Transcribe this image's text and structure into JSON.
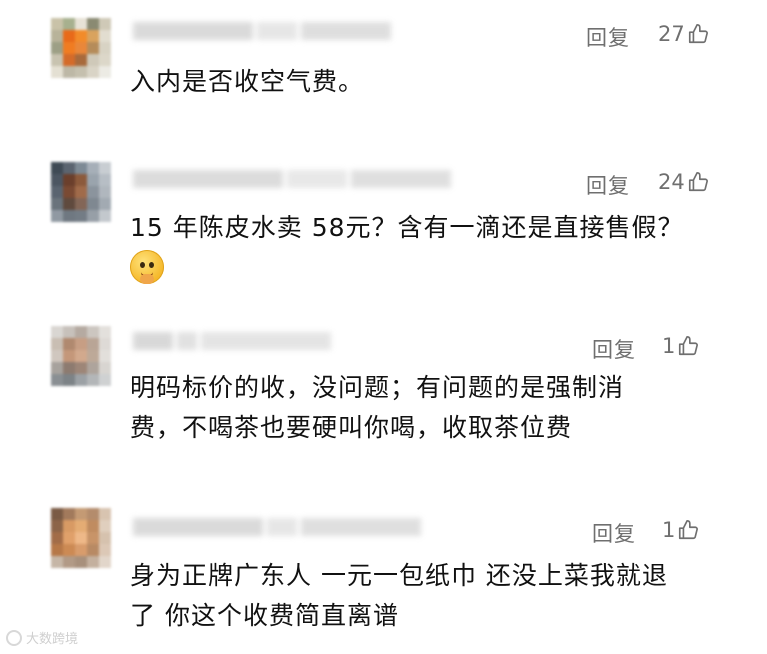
{
  "comments": [
    {
      "reply_label": "回复",
      "likes": "27",
      "text_lines": [
        "入内是否收空气费。"
      ],
      "avatar_colors": [
        "#c9c2a8",
        "#a7b08e",
        "#e7e2d6",
        "#8a8a72",
        "#cfc9b7",
        "#b8b39a",
        "#e86a1a",
        "#f28b2a",
        "#d9a35e",
        "#e2ddd0",
        "#9d9f86",
        "#f07c22",
        "#e9873a",
        "#b58c5a",
        "#d8d3c4",
        "#c8c3b0",
        "#d46b2a",
        "#a86a3c",
        "#cfc9b9",
        "#dcd7c9",
        "#e4e0d3",
        "#bdb8a6",
        "#c5c0ae",
        "#d9d4c6",
        "#ecebe4"
      ]
    },
    {
      "reply_label": "回复",
      "likes": "24",
      "text_lines": [
        "15 年陈皮水卖 58元？含有一滴还是直接售假？"
      ],
      "avatar_colors": [
        "#3f4a55",
        "#5b6470",
        "#7e8a95",
        "#a6afb8",
        "#c8cdd2",
        "#4c5662",
        "#6b3f2c",
        "#8c5a3c",
        "#9aa4ad",
        "#b7bec5",
        "#5a6470",
        "#7a4a33",
        "#a06b4a",
        "#8b949d",
        "#b0b7be",
        "#6a737c",
        "#5f4a3e",
        "#836657",
        "#7f8891",
        "#a2aab2",
        "#9099a2",
        "#6f7881",
        "#737c85",
        "#979fa7",
        "#c3c8cd"
      ]
    },
    {
      "reply_label": "回复",
      "likes": "1",
      "text_lines": [
        "明码标价的收，没问题；有问题的是强制消",
        "费，不喝茶也要硬叫你喝，收取茶位费"
      ],
      "avatar_colors": [
        "#d9d6d2",
        "#c7c1bb",
        "#b5aaa1",
        "#ccc6c0",
        "#e3e0dc",
        "#c9beb3",
        "#b0896f",
        "#c79e84",
        "#b9a596",
        "#dedad6",
        "#d0c7bf",
        "#c4977a",
        "#d2a98d",
        "#bda998",
        "#e2dfdb",
        "#a7a29d",
        "#8d7b70",
        "#9d8678",
        "#aea49c",
        "#d8d5d1",
        "#8a8f93",
        "#7d8387",
        "#9ca1a5",
        "#b3b6b8",
        "#cfd1d2"
      ]
    },
    {
      "reply_label": "回复",
      "likes": "1",
      "text_lines": [
        "身为正牌广东人 一元一包纸巾 还没上菜我就退",
        "了 你这个收费简直离谱"
      ],
      "avatar_colors": [
        "#7a5a44",
        "#a27a5c",
        "#c49a74",
        "#b48c6c",
        "#d8c4b0",
        "#8c6448",
        "#d89a64",
        "#e4ac74",
        "#c08c60",
        "#e0cfbe",
        "#a26c48",
        "#e0a06a",
        "#eeb888",
        "#c89468",
        "#d6c2ae",
        "#b67848",
        "#cc8a54",
        "#d89c6c",
        "#b88a64",
        "#dcc8b6",
        "#c6b6a6",
        "#b29a86",
        "#a8907c",
        "#c4b09e",
        "#e2d6ca"
      ]
    }
  ],
  "watermark": "大数跨境"
}
